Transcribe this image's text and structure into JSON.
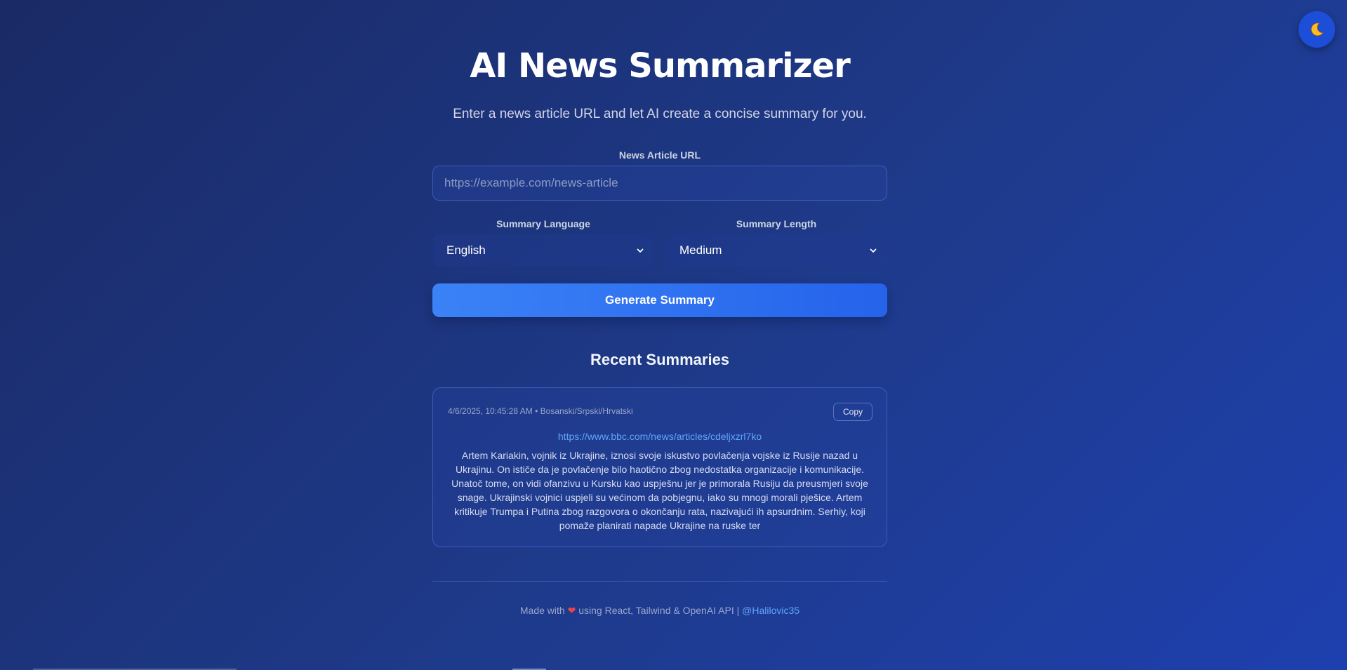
{
  "header": {
    "title": "AI News Summarizer",
    "subtitle": "Enter a news article URL and let AI create a concise summary for you.",
    "theme_toggle_icon": "moon-icon"
  },
  "form": {
    "url_label": "News Article URL",
    "url_placeholder": "https://example.com/news-article",
    "url_value": "",
    "language_label": "Summary Language",
    "language_value": "English",
    "length_label": "Summary Length",
    "length_value": "Medium",
    "generate_label": "Generate Summary"
  },
  "recent": {
    "heading": "Recent Summaries",
    "items": [
      {
        "timestamp": "4/6/2025, 10:45:28 AM",
        "separator": "•",
        "language": "Bosanski/Srpski/Hrvatski",
        "copy_label": "Copy",
        "url": "https://www.bbc.com/news/articles/cdeljxzrl7ko",
        "summary": "Artem Kariakin, vojnik iz Ukrajine, iznosi svoje iskustvo povlačenja vojske iz Rusije nazad u Ukrajinu. On ističe da je povlačenje bilo haotično zbog nedostatka organizacije i komunikacije. Unatoč tome, on vidi ofanzivu u Kursku kao uspješnu jer je primorala Rusiju da preusmjeri svoje snage. Ukrajinski vojnici uspjeli su većinom da pobjegnu, iako su mnogi morali pješice. Artem kritikuje Trumpa i Putina zbog razgovora o okončanju rata, nazivajući ih apsurdnim. Serhiy, koji pomaže planirati napade Ukrajine na ruske ter"
      }
    ]
  },
  "footer": {
    "made_with": "Made with",
    "heart": "❤",
    "using": "using React, Tailwind & OpenAI API |",
    "handle": "@Halilovic35"
  },
  "colors": {
    "accent": "#3b82f6",
    "link": "#60a5fa",
    "toggle_bg": "#1d4ed8",
    "heart": "#ef4444"
  }
}
